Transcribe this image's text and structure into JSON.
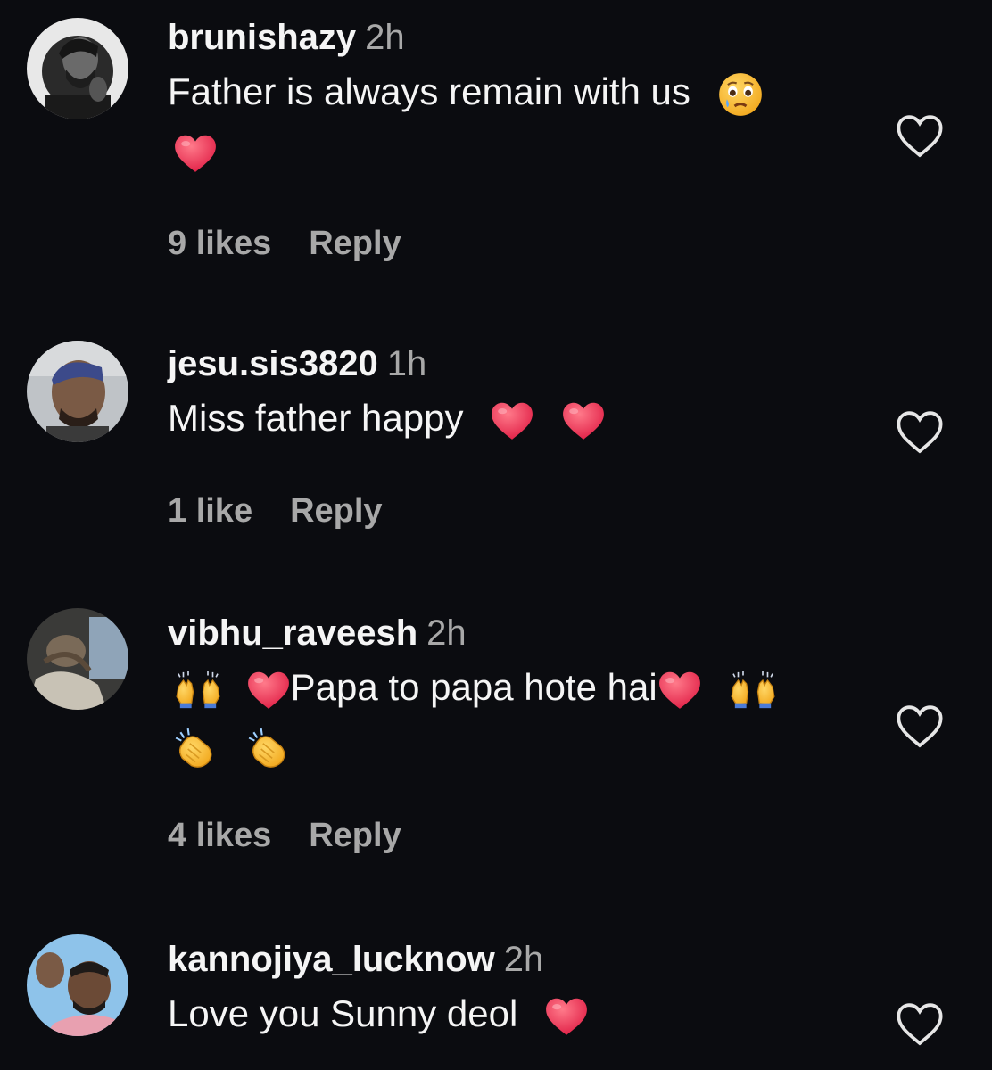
{
  "comments": [
    {
      "username": "brunishazy",
      "time": "2h",
      "text_line1": "Father is always remain with us",
      "emoji_line1": [
        "crying-face-icon"
      ],
      "emoji_line2": [
        "red-heart-icon"
      ],
      "likes": "9 likes",
      "reply": "Reply"
    },
    {
      "username": "jesu.sis3820",
      "time": "1h",
      "text_line1": "Miss father happy",
      "emoji_line1": [
        "red-heart-icon",
        "red-heart-icon"
      ],
      "likes": "1 like",
      "reply": "Reply"
    },
    {
      "username": "vibhu_raveesh",
      "time": "2h",
      "text_line1": "Papa to papa hote hai",
      "emoji_line1": [
        "raising-hands-icon",
        "red-heart-icon",
        "red-heart-icon",
        "raising-hands-icon"
      ],
      "emoji_line2": [
        "clapping-hands-icon",
        "clapping-hands-icon"
      ],
      "likes": "4 likes",
      "reply": "Reply"
    },
    {
      "username": "kannojiya_lucknow",
      "time": "2h",
      "text_line1": "Love you Sunny deol",
      "emoji_line1": [
        "red-heart-icon"
      ]
    }
  ],
  "colors": {
    "background": "#0b0c10",
    "primary_text": "#f5f5f5",
    "secondary_text": "#a8a8a8",
    "heart": "#e8344e"
  }
}
